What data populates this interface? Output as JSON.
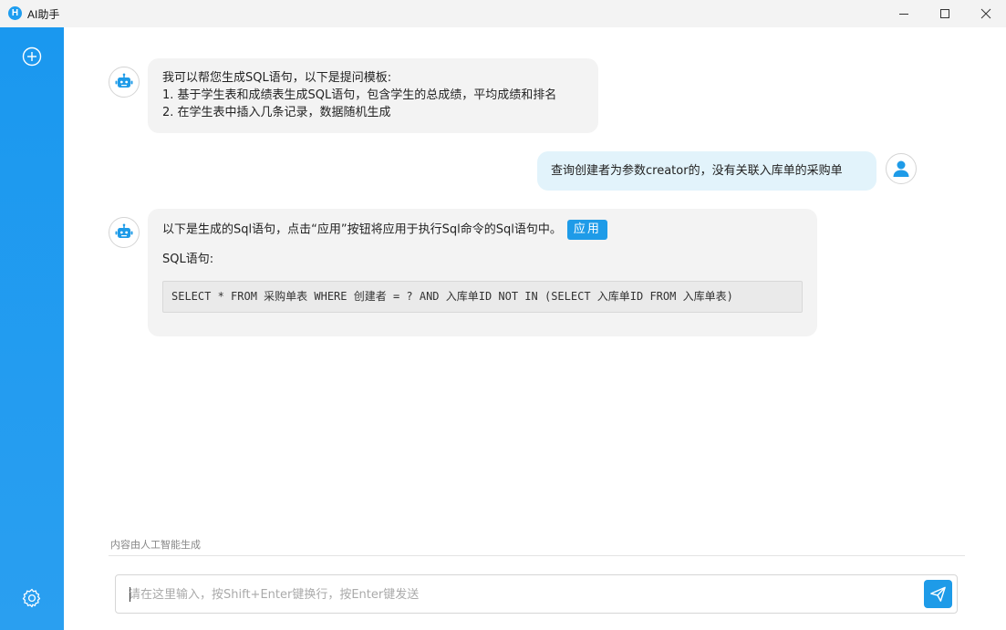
{
  "window": {
    "title": "AI助手",
    "logo_letter": "H"
  },
  "sidebar": {
    "new_chat_icon": "plus-circle-icon",
    "settings_icon": "gear-icon"
  },
  "messages": [
    {
      "role": "assistant",
      "lines": [
        "我可以帮您生成SQL语句，以下是提问模板:",
        "1. 基于学生表和成绩表生成SQL语句，包含学生的总成绩，平均成绩和排名",
        "2. 在学生表中插入几条记录，数据随机生成"
      ]
    },
    {
      "role": "user",
      "text": "查询创建者为参数creator的，没有关联入库单的采购单"
    },
    {
      "role": "assistant",
      "intro": "以下是生成的Sql语句，点击“应用”按钮将应用于执行Sql命令的Sql语句中。",
      "apply_label": "应用",
      "sql_label": "SQL语句:",
      "sql_code": "SELECT * FROM 采购单表 WHERE 创建者 = ? AND 入库单ID NOT IN (SELECT 入库单ID FROM 入库单表)"
    }
  ],
  "footer": {
    "ai_note": "内容由人工智能生成",
    "input_placeholder": "请在这里输入，按Shift+Enter键换行，按Enter键发送",
    "input_value": ""
  },
  "colors": {
    "accent": "#1e9be8",
    "sidebar": "#1a98ef",
    "assistant_bubble": "#f3f3f3",
    "user_bubble": "#e2f3fb"
  }
}
